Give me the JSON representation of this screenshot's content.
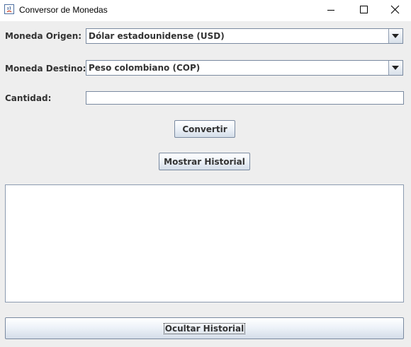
{
  "window": {
    "title": "Conversor de Monedas"
  },
  "form": {
    "source_label": "Moneda Origen:",
    "source_value": "Dólar estadounidense (USD)",
    "target_label": "Moneda Destino:",
    "target_value": "Peso colombiano (COP)",
    "amount_label": "Cantidad:",
    "amount_value": ""
  },
  "buttons": {
    "convert": "Convertir",
    "show_history": "Mostrar Historial",
    "hide_history": "Ocultar Historial"
  },
  "history": {
    "text": ""
  }
}
